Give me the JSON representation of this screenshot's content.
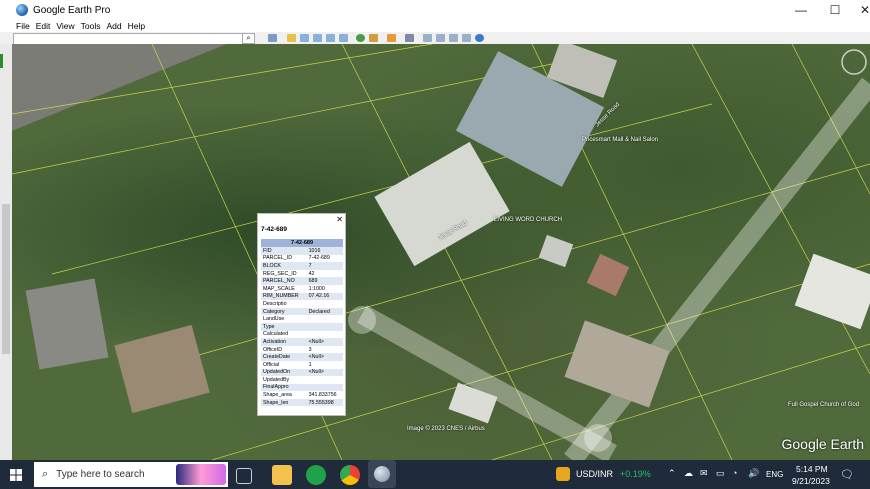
{
  "window": {
    "title": "Google Earth Pro",
    "controls": {
      "minimize": "—",
      "maximize": "☐",
      "close": "✕"
    }
  },
  "menu": [
    "File",
    "Edit",
    "View",
    "Tools",
    "Add",
    "Help"
  ],
  "search": {
    "value": "",
    "placeholder": ""
  },
  "map": {
    "labels": {
      "street_1": "Jesse Road",
      "street_2": "Jesse Road",
      "place_1": "Pricesmart Mall & Nail Salon",
      "place_2": "LIVING WORD CHURCH",
      "place_3": "Full Gospel Church of God",
      "attribution": "Image © 2023 CNES / Airbus"
    },
    "logo": "Google Earth"
  },
  "popup": {
    "title": "7-42-689",
    "header": "7-42-689",
    "close": "✕",
    "rows": [
      {
        "key": "FID",
        "value": "1016"
      },
      {
        "key": "PARCEL_ID",
        "value": "7-42-689"
      },
      {
        "key": "BLOCK",
        "value": "7"
      },
      {
        "key": "REG_SEC_ID",
        "value": "42"
      },
      {
        "key": "PARCEL_NO",
        "value": "689"
      },
      {
        "key": "MAP_SCALE",
        "value": "1:1000"
      },
      {
        "key": "RIM_NUMBER",
        "value": "07.42.16"
      },
      {
        "key": "Descriptio",
        "value": ""
      },
      {
        "key": "Category",
        "value": "Declared"
      },
      {
        "key": "LandUse",
        "value": ""
      },
      {
        "key": "Type",
        "value": ""
      },
      {
        "key": "Calculated",
        "value": ""
      },
      {
        "key": "Activation",
        "value": "<Null>"
      },
      {
        "key": "OfficeID",
        "value": "3"
      },
      {
        "key": "CreateDate",
        "value": "<Null>"
      },
      {
        "key": "Official",
        "value": "1"
      },
      {
        "key": "UpdatedOn",
        "value": "<Null>"
      },
      {
        "key": "UpdatedBy",
        "value": ""
      },
      {
        "key": "FinalAppro",
        "value": ""
      },
      {
        "key": "Shape_area",
        "value": "341.833756"
      },
      {
        "key": "Shape_len",
        "value": "75.555398"
      }
    ]
  },
  "taskbar": {
    "search_placeholder": "Type here to search",
    "ticker": {
      "symbol": "USD/INR",
      "change": "+0.19%"
    },
    "language": "ENG",
    "time": "5:14 PM",
    "date": "9/21/2023"
  },
  "colors": {
    "accent_green": "#21c55d",
    "popup_header": "#9db4d8",
    "taskbar_bg": "#1f2a3a"
  }
}
